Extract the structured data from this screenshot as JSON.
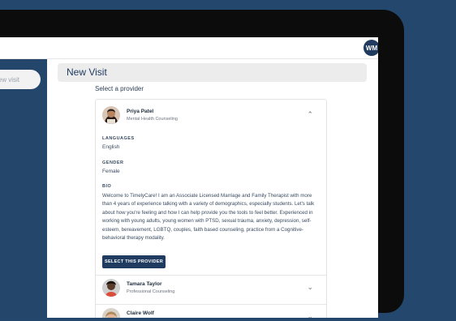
{
  "header": {
    "user_initials": "WM"
  },
  "sidebar": {
    "new_visit_label": "new visit"
  },
  "page": {
    "title": "New Visit",
    "section_label": "Select a provider"
  },
  "providers": [
    {
      "name": "Priya Patel",
      "specialty": "Mental Health Counseling",
      "expanded": true,
      "languages_label": "LANGUAGES",
      "languages": "English",
      "gender_label": "GENDER",
      "gender": "Female",
      "bio_label": "BIO",
      "bio": "Welcome to TimelyCare! I am an Associate Licensed Marriage and Family Therapist with more than 4 years of experience talking with a variety of demographics, especially students. Let's talk about how you're feeling and how I can help provide you the tools to feel better. Experienced in working with young adults, young women with PTSD, sexual trauma, anxiety, depression, self-esteem, bereavement, LGBTQ, couples, faith based counseling, practice from a Cognitive-behavioral therapy modality.",
      "select_label": "SELECT THIS PROVIDER"
    },
    {
      "name": "Tamara Taylor",
      "specialty": "Professional Counseling",
      "expanded": false
    },
    {
      "name": "Claire Wolf",
      "specialty": "",
      "expanded": false
    }
  ],
  "colors": {
    "brand_navy": "#1f3b60",
    "background": "#23476d"
  },
  "icons": {
    "expand": "chevron-down-icon",
    "collapse": "chevron-up-icon"
  }
}
